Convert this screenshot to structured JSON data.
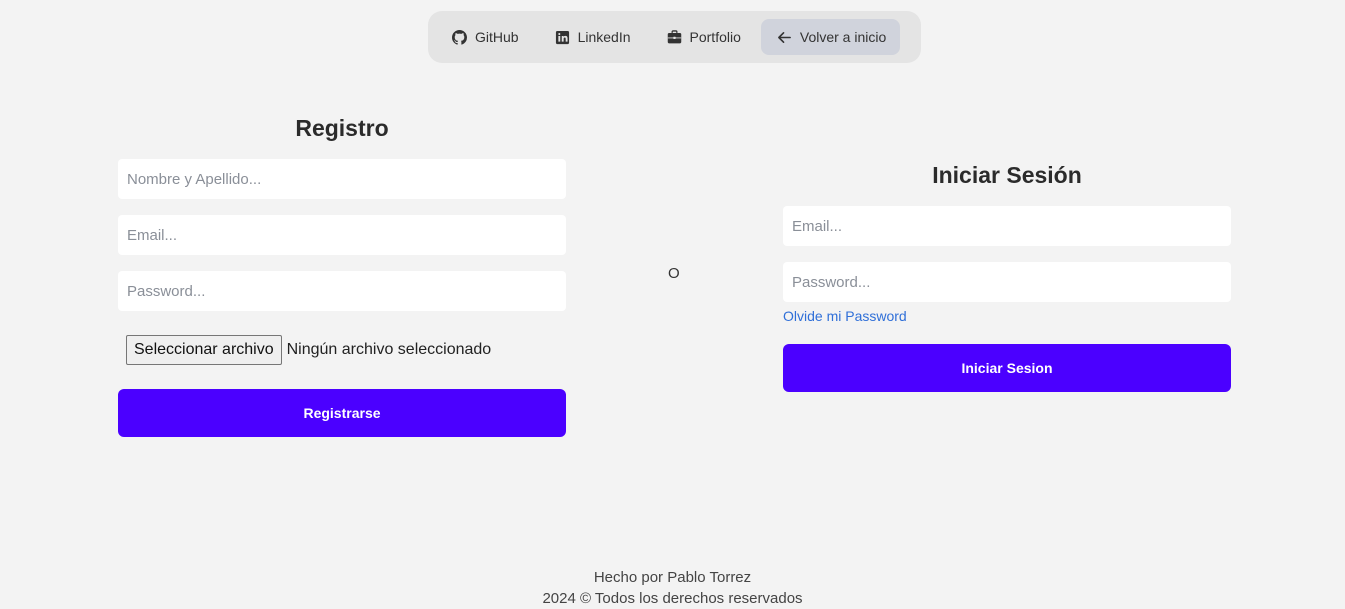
{
  "nav": {
    "items": [
      {
        "label": "GitHub",
        "icon": "github-icon"
      },
      {
        "label": "LinkedIn",
        "icon": "linkedin-icon"
      },
      {
        "label": "Portfolio",
        "icon": "briefcase-icon"
      },
      {
        "label": "Volver a inicio",
        "icon": "arrow-left-icon",
        "active": true
      }
    ]
  },
  "register": {
    "title": "Registro",
    "name_placeholder": "Nombre y Apellido...",
    "email_placeholder": "Email...",
    "password_placeholder": "Password...",
    "file_button": "Seleccionar archivo",
    "file_status": "Ningún archivo seleccionado",
    "submit_label": "Registrarse"
  },
  "separator": "O",
  "login": {
    "title": "Iniciar Sesión",
    "email_placeholder": "Email...",
    "password_placeholder": "Password...",
    "forgot_label": "Olvide mi Password",
    "submit_label": "Iniciar Sesion"
  },
  "footer": {
    "author": "Hecho por Pablo Torrez",
    "rights": "2024 © Todos los derechos reservados"
  },
  "colors": {
    "background": "#f3f3f3",
    "nav_background": "#e4e4e4",
    "nav_active": "#d0d3dc",
    "accent": "#4b00ff",
    "link": "#2f6fd8"
  }
}
